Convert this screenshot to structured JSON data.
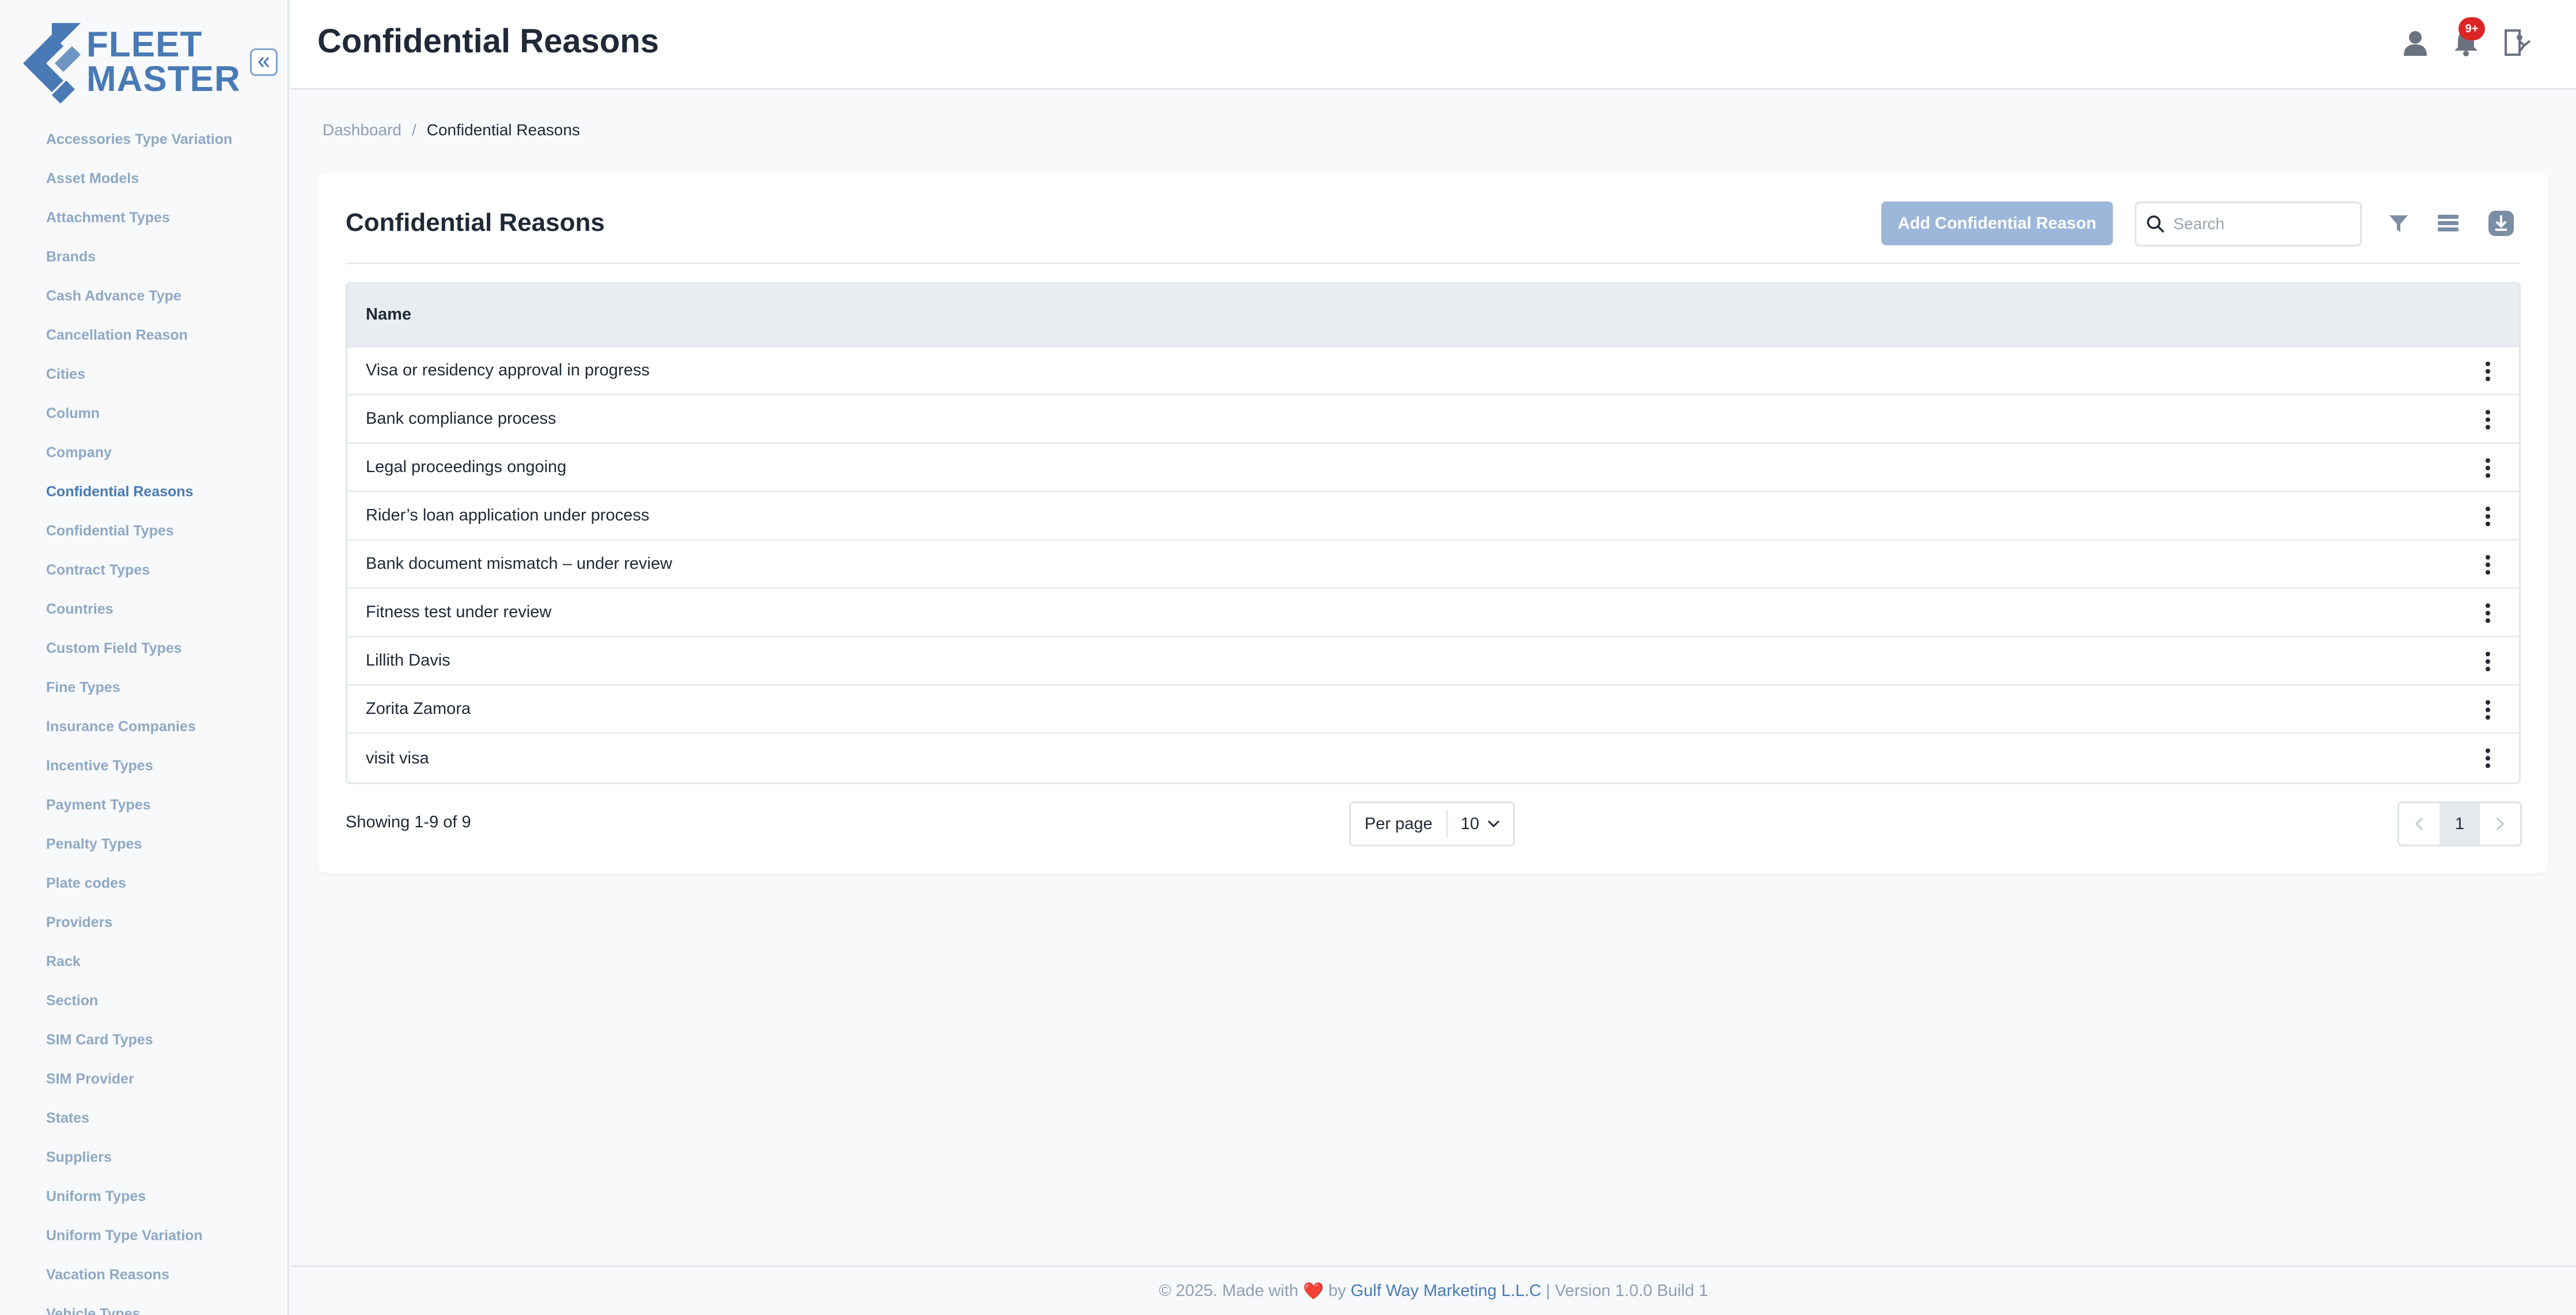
{
  "app": {
    "logo_line1": "FLEET",
    "logo_line2": "MASTER",
    "brand_color": "#4a7ab5"
  },
  "sidebar": {
    "items": [
      {
        "label": "Accessories Type Variation"
      },
      {
        "label": "Asset Models"
      },
      {
        "label": "Attachment Types"
      },
      {
        "label": "Brands"
      },
      {
        "label": "Cash Advance Type"
      },
      {
        "label": "Cancellation Reason"
      },
      {
        "label": "Cities"
      },
      {
        "label": "Column"
      },
      {
        "label": "Company"
      },
      {
        "label": "Confidential Reasons",
        "active": true
      },
      {
        "label": "Confidential Types"
      },
      {
        "label": "Contract Types"
      },
      {
        "label": "Countries"
      },
      {
        "label": "Custom Field Types"
      },
      {
        "label": "Fine Types"
      },
      {
        "label": "Insurance Companies"
      },
      {
        "label": "Incentive Types"
      },
      {
        "label": "Payment Types"
      },
      {
        "label": "Penalty Types"
      },
      {
        "label": "Plate codes"
      },
      {
        "label": "Providers"
      },
      {
        "label": "Rack"
      },
      {
        "label": "Section"
      },
      {
        "label": "SIM Card Types"
      },
      {
        "label": "SIM Provider"
      },
      {
        "label": "States"
      },
      {
        "label": "Suppliers"
      },
      {
        "label": "Uniform Types"
      },
      {
        "label": "Uniform Type Variation"
      },
      {
        "label": "Vacation Reasons"
      },
      {
        "label": "Vehicle Types"
      }
    ]
  },
  "header": {
    "title": "Confidential Reasons",
    "notification_badge": "9+",
    "icons": [
      "user-icon",
      "bell-icon",
      "logout-icon"
    ]
  },
  "breadcrumb": {
    "home": "Dashboard",
    "separator": "/",
    "current": "Confidential Reasons"
  },
  "card": {
    "title": "Confidential Reasons",
    "add_button_label": "Add Confidential Reason",
    "search_placeholder": "Search",
    "tool_icons": [
      "filter-icon",
      "columns-icon",
      "download-icon"
    ]
  },
  "table": {
    "columns": [
      "Name"
    ],
    "rows": [
      {
        "name": "Visa or residency approval in progress"
      },
      {
        "name": "Bank compliance process"
      },
      {
        "name": "Legal proceedings ongoing"
      },
      {
        "name": "Rider’s loan application under process"
      },
      {
        "name": "Bank document mismatch – under review"
      },
      {
        "name": "Fitness test under review"
      },
      {
        "name": "Lillith Davis"
      },
      {
        "name": "Zorita Zamora"
      },
      {
        "name": "visit visa"
      }
    ]
  },
  "pagination": {
    "showing": "Showing 1-9 of 9",
    "per_page_label": "Per page",
    "per_page_value": "10",
    "current_page": "1"
  },
  "footer": {
    "prefix": "© 2025. Made with",
    "heart": "❤️",
    "by": "by",
    "company": "Gulf Way Marketing L.L.C",
    "version": "| Version 1.0.0 Build 1"
  }
}
